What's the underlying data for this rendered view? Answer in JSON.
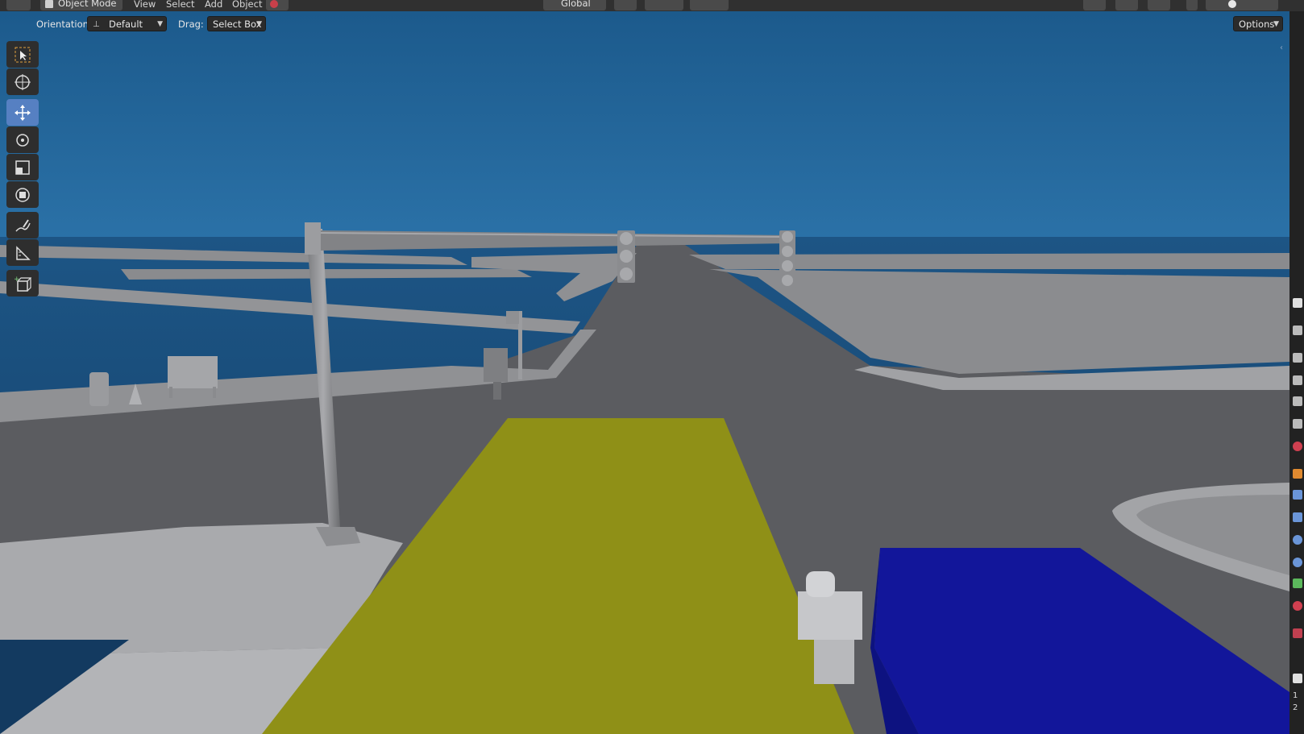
{
  "header": {
    "mode": "Object Mode",
    "menus": [
      "View",
      "Select",
      "Add",
      "Object"
    ],
    "transform_orientation": "Global"
  },
  "tool_header": {
    "orientation_label": "Orientation:",
    "orientation_value": "Default",
    "drag_label": "Drag:",
    "drag_value": "Select Box",
    "options_label": "Options"
  },
  "toolbar": {
    "tools": [
      "select-box",
      "cursor",
      "move",
      "rotate",
      "scale",
      "transform",
      "annotate",
      "measure",
      "add-cube"
    ],
    "active_tool": "move"
  },
  "right_strip": {
    "numbers": [
      "1",
      "2"
    ]
  },
  "colors": {
    "sky_top": "#1c5a8c",
    "sky_bottom": "#2a6fa3",
    "road": "#5b5c60",
    "sidewalk": "#8a8b8e",
    "yellow_box": "#8f9017",
    "blue_box": "#12169a",
    "active_tool": "#5680c2"
  }
}
